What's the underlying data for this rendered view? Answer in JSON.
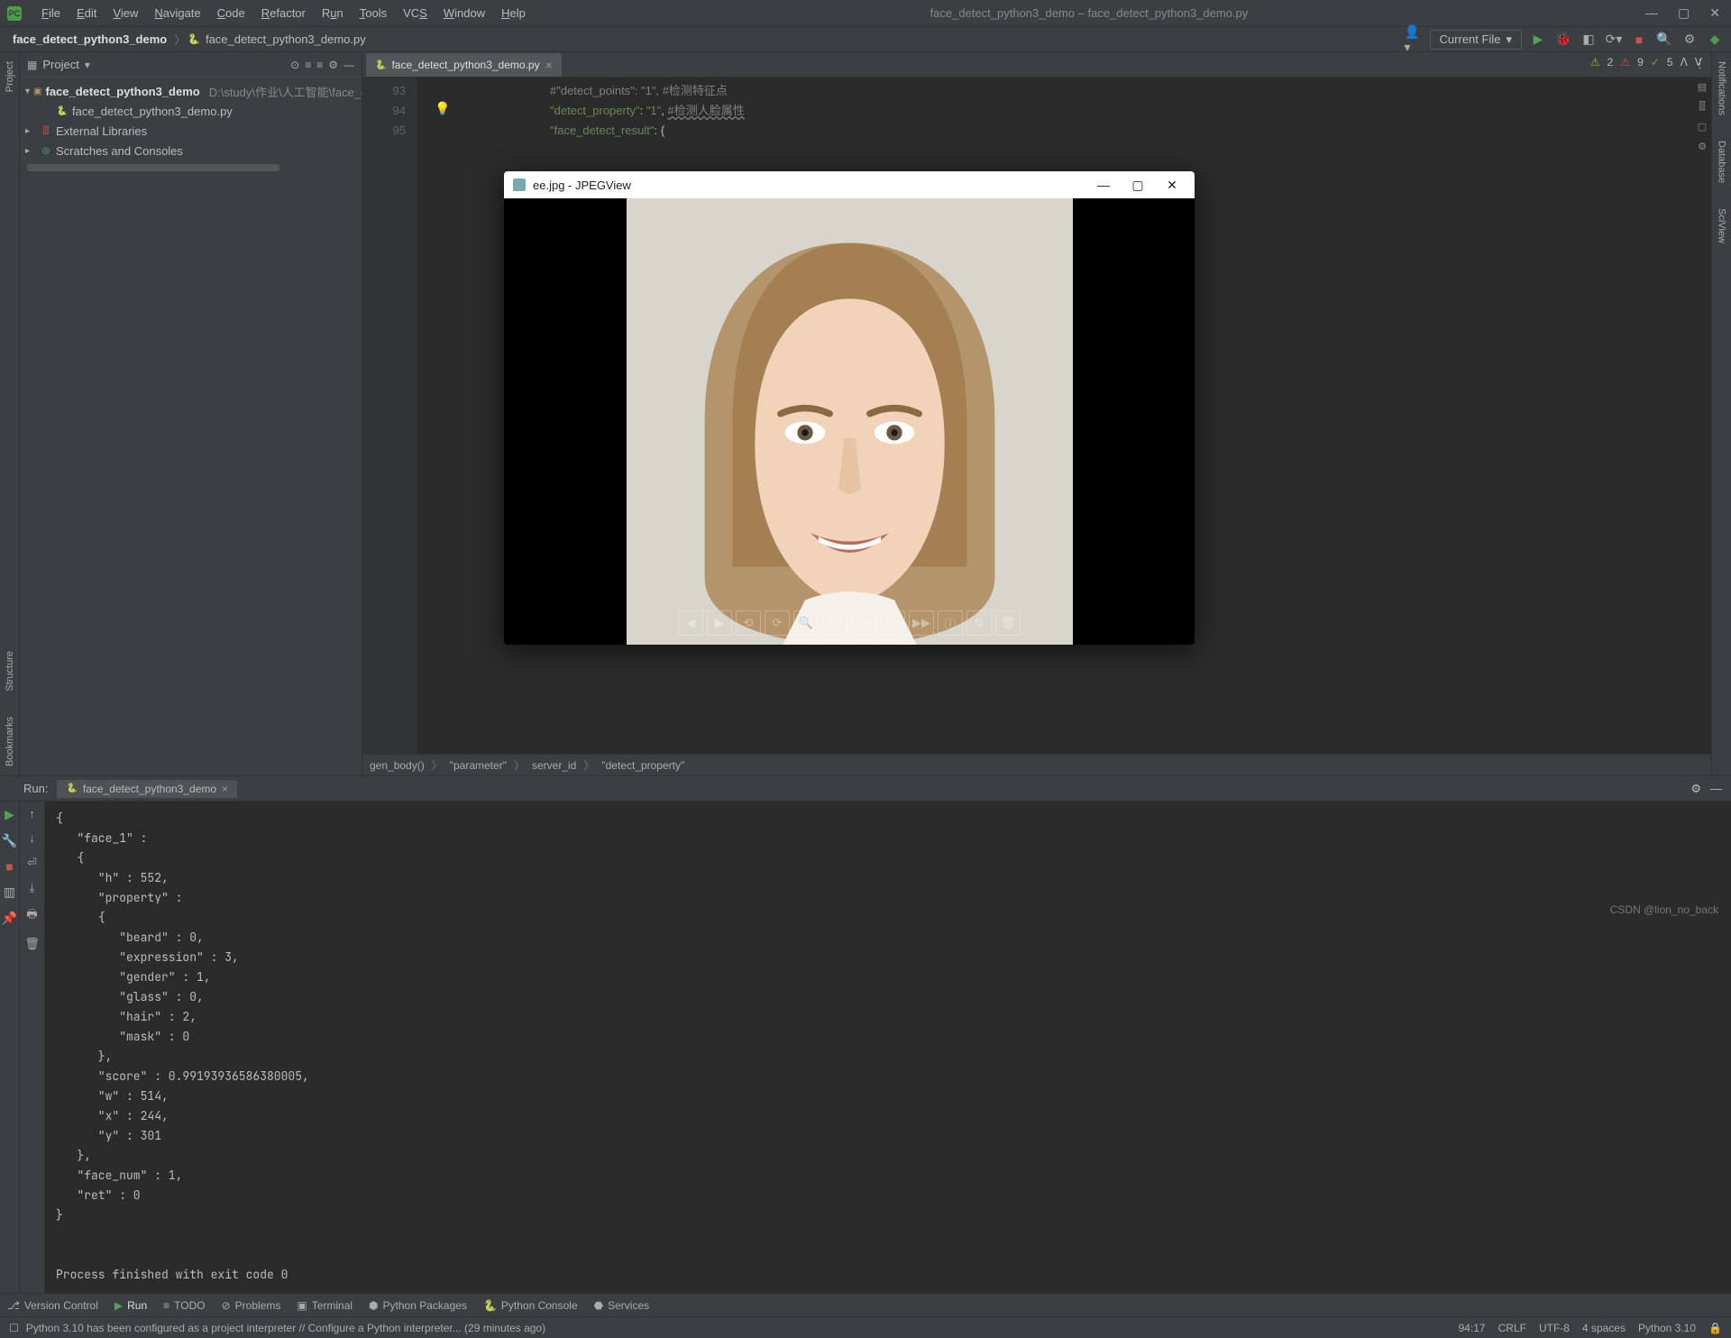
{
  "window": {
    "title": "face_detect_python3_demo – face_detect_python3_demo.py",
    "win_min": "—",
    "win_max": "▢",
    "win_close": "✕"
  },
  "menu": [
    "File",
    "Edit",
    "View",
    "Navigate",
    "Code",
    "Refactor",
    "Run",
    "Tools",
    "VCS",
    "Window",
    "Help"
  ],
  "breadcrumbs": {
    "project": "face_detect_python3_demo",
    "file": "face_detect_python3_demo.py"
  },
  "nav_right": {
    "run_config": "Current File"
  },
  "project_panel": {
    "title": "Project",
    "root": {
      "name": "face_detect_python3_demo",
      "path": "D:\\study\\作业\\人工智能\\face_d"
    },
    "file": "face_detect_python3_demo.py",
    "ext_lib": "External Libraries",
    "scratches": "Scratches and Consoles"
  },
  "editor_tab": {
    "name": "face_detect_python3_demo.py"
  },
  "inspection": {
    "warn_count": "2",
    "err_count": "9",
    "typo_count": "5"
  },
  "code": {
    "lines": [
      "93",
      "94",
      "95"
    ],
    "l93": "#\"detect_points\": \"1\", #检测特征点",
    "l94_a": "\"detect_property\"",
    "l94_b": ": ",
    "l94_c": "\"1\"",
    "l94_d": ", ",
    "l94_e": "#检测人脸属性",
    "l95_a": "\"face_detect_result\"",
    "l95_b": ": {"
  },
  "breadcrumb_fn": [
    "gen_body()",
    "\"parameter\"",
    "server_id",
    "\"detect_property\""
  ],
  "run": {
    "title": "Run:",
    "tab": "face_detect_python3_demo",
    "output": "{\n   \"face_1\" : \n   {\n      \"h\" : 552,\n      \"property\" : \n      {\n         \"beard\" : 0,\n         \"expression\" : 3,\n         \"gender\" : 1,\n         \"glass\" : 0,\n         \"hair\" : 2,\n         \"mask\" : 0\n      },\n      \"score\" : 0.99193936586380005,\n      \"w\" : 514,\n      \"x\" : 244,\n      \"y\" : 301\n   },\n   \"face_num\" : 1,\n   \"ret\" : 0\n}\n\n\nProcess finished with exit code 0"
  },
  "bottom_tabs": {
    "vc": "Version Control",
    "run": "Run",
    "todo": "TODO",
    "problems": "Problems",
    "terminal": "Terminal",
    "pkg": "Python Packages",
    "console": "Python Console",
    "services": "Services"
  },
  "status": {
    "msg": "Python 3.10 has been configured as a project interpreter // Configure a Python interpreter... (29 minutes ago)",
    "caret": "94:17",
    "eol": "CRLF",
    "enc": "UTF-8",
    "indent": "4 spaces",
    "py": "Python 3.10"
  },
  "left_tools": [
    "Project",
    "Structure",
    "Bookmarks"
  ],
  "right_tools": [
    "Notifications",
    "Database",
    "SciView"
  ],
  "jpeg": {
    "title": "ee.jpg - JPEGView"
  },
  "watermark": "CSDN @lion_no_back"
}
